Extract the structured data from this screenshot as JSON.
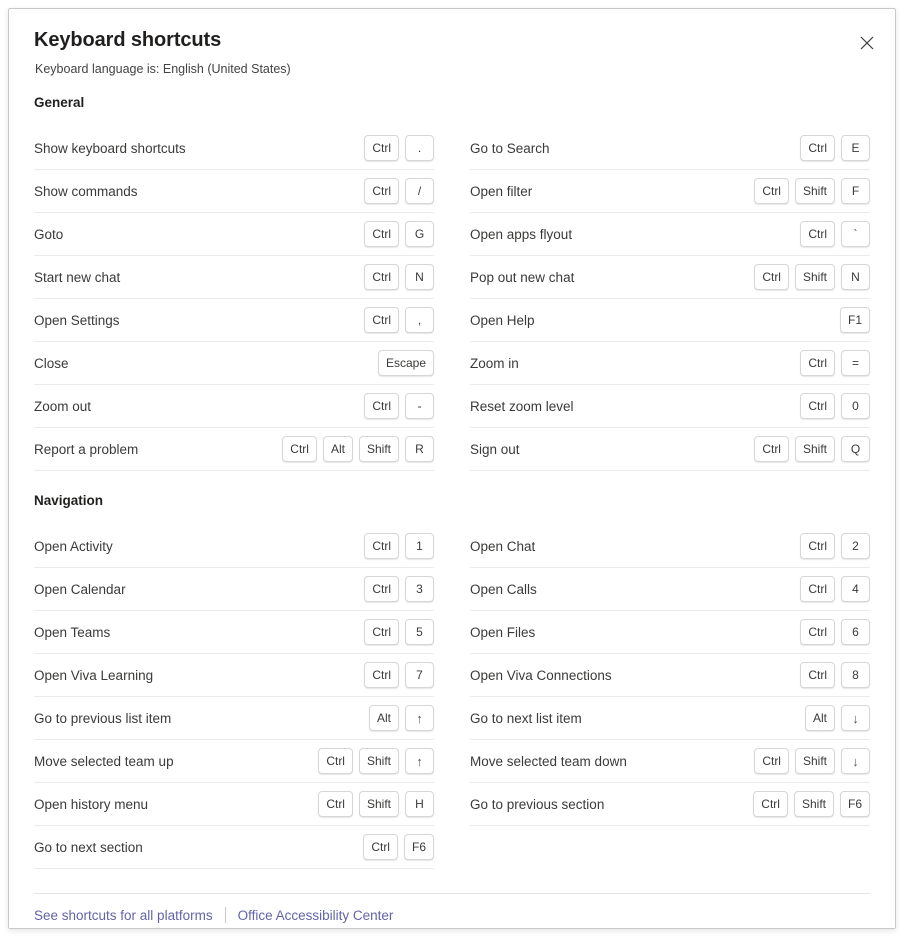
{
  "dialog": {
    "title": "Keyboard shortcuts",
    "subtitle": "Keyboard language is: English (United States)",
    "close_label": "Close",
    "accent_link_color": "#6264a7",
    "border_color": "#c9c9c9",
    "row_divider_color": "#ebebeb"
  },
  "sections": [
    {
      "title": "General",
      "left": [
        {
          "label": "Show keyboard shortcuts",
          "keys": [
            "Ctrl",
            "."
          ]
        },
        {
          "label": "Show commands",
          "keys": [
            "Ctrl",
            "/"
          ]
        },
        {
          "label": "Goto",
          "keys": [
            "Ctrl",
            "G"
          ]
        },
        {
          "label": "Start new chat",
          "keys": [
            "Ctrl",
            "N"
          ]
        },
        {
          "label": "Open Settings",
          "keys": [
            "Ctrl",
            ","
          ]
        },
        {
          "label": "Close",
          "keys": [
            "Escape"
          ]
        },
        {
          "label": "Zoom out",
          "keys": [
            "Ctrl",
            "-"
          ]
        },
        {
          "label": "Report a problem",
          "keys": [
            "Ctrl",
            "Alt",
            "Shift",
            "R"
          ]
        }
      ],
      "right": [
        {
          "label": "Go to Search",
          "keys": [
            "Ctrl",
            "E"
          ]
        },
        {
          "label": "Open filter",
          "keys": [
            "Ctrl",
            "Shift",
            "F"
          ]
        },
        {
          "label": "Open apps flyout",
          "keys": [
            "Ctrl",
            "`"
          ]
        },
        {
          "label": "Pop out new chat",
          "keys": [
            "Ctrl",
            "Shift",
            "N"
          ]
        },
        {
          "label": "Open Help",
          "keys": [
            "F1"
          ]
        },
        {
          "label": "Zoom in",
          "keys": [
            "Ctrl",
            "="
          ]
        },
        {
          "label": "Reset zoom level",
          "keys": [
            "Ctrl",
            "0"
          ]
        },
        {
          "label": "Sign out",
          "keys": [
            "Ctrl",
            "Shift",
            "Q"
          ]
        }
      ]
    },
    {
      "title": "Navigation",
      "left": [
        {
          "label": "Open Activity",
          "keys": [
            "Ctrl",
            "1"
          ]
        },
        {
          "label": "Open Calendar",
          "keys": [
            "Ctrl",
            "3"
          ]
        },
        {
          "label": "Open Teams",
          "keys": [
            "Ctrl",
            "5"
          ]
        },
        {
          "label": "Open Viva Learning",
          "keys": [
            "Ctrl",
            "7"
          ]
        },
        {
          "label": "Go to previous list item",
          "keys": [
            "Alt",
            "↑"
          ]
        },
        {
          "label": "Move selected team up",
          "keys": [
            "Ctrl",
            "Shift",
            "↑"
          ]
        },
        {
          "label": "Open history menu",
          "keys": [
            "Ctrl",
            "Shift",
            "H"
          ]
        },
        {
          "label": "Go to next section",
          "keys": [
            "Ctrl",
            "F6"
          ]
        }
      ],
      "right": [
        {
          "label": "Open Chat",
          "keys": [
            "Ctrl",
            "2"
          ]
        },
        {
          "label": "Open Calls",
          "keys": [
            "Ctrl",
            "4"
          ]
        },
        {
          "label": "Open Files",
          "keys": [
            "Ctrl",
            "6"
          ]
        },
        {
          "label": "Open Viva Connections",
          "keys": [
            "Ctrl",
            "8"
          ]
        },
        {
          "label": "Go to next list item",
          "keys": [
            "Alt",
            "↓"
          ]
        },
        {
          "label": "Move selected team down",
          "keys": [
            "Ctrl",
            "Shift",
            "↓"
          ]
        },
        {
          "label": "Go to previous section",
          "keys": [
            "Ctrl",
            "Shift",
            "F6"
          ]
        }
      ]
    }
  ],
  "footer": {
    "links": [
      {
        "label": "See shortcuts for all platforms"
      },
      {
        "label": "Office Accessibility Center"
      }
    ]
  }
}
